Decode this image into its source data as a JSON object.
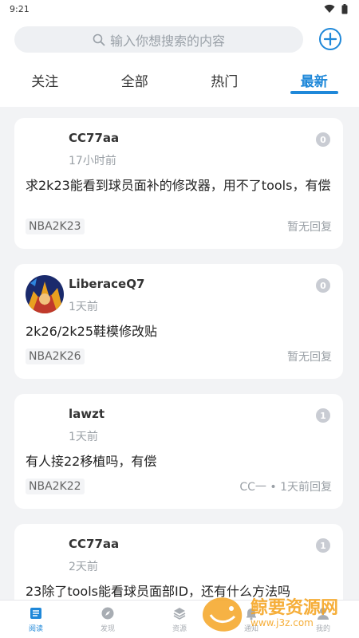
{
  "status": {
    "time": "9:21"
  },
  "search": {
    "placeholder": "输入你想搜索的内容"
  },
  "tabs": [
    {
      "label": "关注"
    },
    {
      "label": "全部"
    },
    {
      "label": "热门"
    },
    {
      "label": "最新",
      "active": true
    }
  ],
  "posts": [
    {
      "user": "CC77aa",
      "time": "17小时前",
      "count": "0",
      "content": "求2k23能看到球员面补的修改器，用不了tools，有偿",
      "tag": "NBA2K23",
      "reply": "暂无回复"
    },
    {
      "user": "LiberaceQ7",
      "time": "1天前",
      "count": "0",
      "content": "2k26/2k25鞋模修改贴",
      "tag": "NBA2K26",
      "reply": "暂无回复"
    },
    {
      "user": "lawzt",
      "time": "1天前",
      "count": "1",
      "content": "有人接22移植吗，有偿",
      "tag": "NBA2K22",
      "reply": "CC一 • 1天前回复"
    },
    {
      "user": "CC77aa",
      "time": "2天前",
      "count": "1",
      "content": "23除了tools能看球员面部ID，还有什么方法吗",
      "tag": "",
      "reply": ""
    }
  ],
  "nav": [
    {
      "label": "阅读",
      "icon": "book-icon",
      "active": true
    },
    {
      "label": "发现",
      "icon": "compass-icon"
    },
    {
      "label": "资源",
      "icon": "layers-icon"
    },
    {
      "label": "通知",
      "icon": "bell-icon"
    },
    {
      "label": "我的",
      "icon": "user-icon"
    }
  ],
  "watermark": {
    "text": "鲸要资源网",
    "url": "www.j3z.com"
  },
  "colors": {
    "accent": "#1f88d9",
    "background": "#f2f3f5",
    "badge": "#c9ccd3"
  }
}
